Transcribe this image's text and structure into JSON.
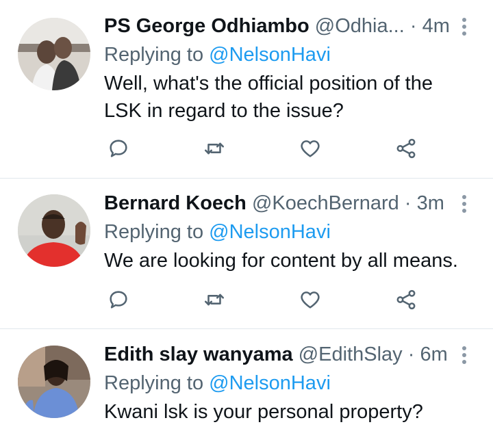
{
  "tweets": [
    {
      "display_name": "PS George Odhiambo",
      "handle": "@Odhia...",
      "separator": "·",
      "time": "4m",
      "replying_prefix": "Replying to",
      "replying_to": "@NelsonHavi",
      "text_lines": [
        "Well, what's the official position of the",
        "LSK in regard to the issue?"
      ]
    },
    {
      "display_name": "Bernard Koech",
      "handle": "@KoechBernard",
      "separator": "·",
      "time": "3m",
      "replying_prefix": "Replying to",
      "replying_to": "@NelsonHavi",
      "text_lines": [
        "We are looking for content by all means."
      ]
    },
    {
      "display_name": "Edith slay wanyama",
      "handle": "@EdithSlay",
      "separator": "·",
      "time": "6m",
      "replying_prefix": "Replying to",
      "replying_to": "@NelsonHavi",
      "text_lines": [
        "Kwani lsk is your personal property?"
      ]
    }
  ],
  "icons": {
    "reply": "reply-icon",
    "retweet": "retweet-icon",
    "like": "heart-icon",
    "share": "share-icon",
    "more": "more-vertical-icon"
  },
  "colors": {
    "link": "#1d9bf0",
    "secondary_text": "#536471",
    "icon": "#536471",
    "divider": "#e1e8ed"
  }
}
